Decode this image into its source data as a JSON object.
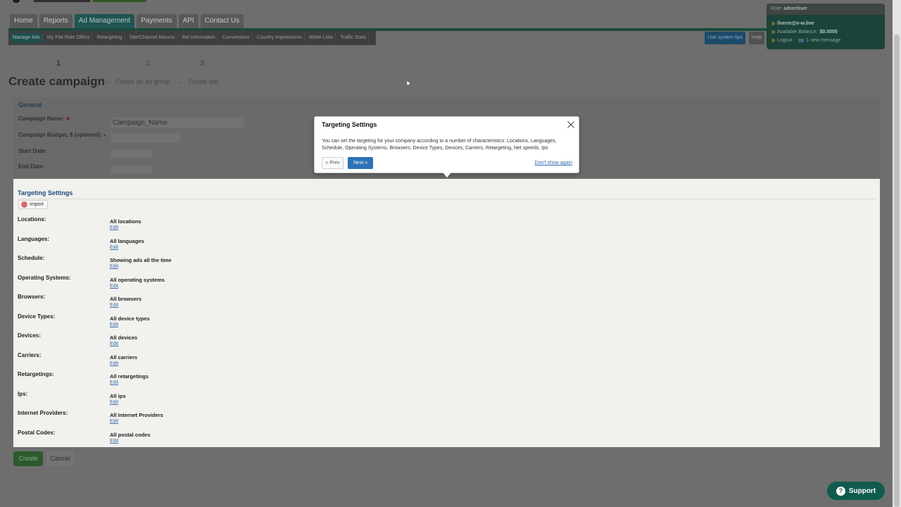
{
  "header": {
    "main_nav": [
      "Home",
      "Reports",
      "Ad Management",
      "Payments",
      "API",
      "Contact Us"
    ],
    "active_main": "Ad Management",
    "sub_nav": [
      "Manage Ads",
      "My Flat Rate Offers",
      "Retargeting",
      "Site/Channel Macros",
      "Bid Information",
      "Conversions",
      "Country Impressions",
      "White Lists",
      "Traffic Stats"
    ],
    "tips_label": "Use system tips",
    "help_label": "Help"
  },
  "user": {
    "role_label": "Role:",
    "role": "advertiser",
    "email": "ilverm@e-w.live",
    "balance_label": "Available Balance:",
    "balance": "$0.0000",
    "logout": "Logout",
    "messages": "1 new message"
  },
  "wizard": {
    "title": "Create campaign",
    "steps": [
      {
        "num": "1",
        "label": ""
      },
      {
        "num": "2",
        "label": "Create an ad group"
      },
      {
        "num": "3",
        "label": "Create ads"
      }
    ],
    "arrow": "→"
  },
  "general": {
    "heading": "General",
    "campaign_name_label": "Campaign Name:",
    "campaign_name_value": "Campaign_Name",
    "budget_label": "Campaign Budget, $ (optional):",
    "start_date_label": "Start Date:",
    "end_date_label": "End Date:"
  },
  "targeting": {
    "heading": "Targeting Settings",
    "import_label": "Import",
    "edit_label": "Edit",
    "rows": [
      {
        "label": "Locations:",
        "value": "All locations"
      },
      {
        "label": "Languages:",
        "value": "All languages"
      },
      {
        "label": "Schedule:",
        "value": "Showing ads all the time"
      },
      {
        "label": "Operating Systems:",
        "value": "All operating systems"
      },
      {
        "label": "Browsers:",
        "value": "All browsers"
      },
      {
        "label": "Device Types:",
        "value": "All device types"
      },
      {
        "label": "Devices:",
        "value": "All devices"
      },
      {
        "label": "Carriers:",
        "value": "All carriers"
      },
      {
        "label": "Retargetings:",
        "value": "All retargetings"
      },
      {
        "label": "Ips:",
        "value": "All ips"
      },
      {
        "label": "Internet Providers:",
        "value": "All Internet Providers"
      },
      {
        "label": "Postal Codes:",
        "value": "All postal codes"
      }
    ]
  },
  "actions": {
    "create": "Create",
    "cancel": "Cancel"
  },
  "support": {
    "label": "Support",
    "icon_glyph": "?"
  },
  "popover": {
    "title": "Targeting Settings",
    "body": "You can set the targeting for your company according to a number of characteristics: Locations, Languages, Schedule, Operating Systems, Browsers, Device Types, Devices, Carriers, Retargeting, Net speeds, Ips",
    "prev": "« Prev",
    "next": "Next »",
    "dont_show": "Don't show again"
  },
  "colors": {
    "accent_green": "#0f5c4e",
    "next_blue": "#2c72b6",
    "link_blue": "#3a6ea8",
    "overlay": "#6e6e6e"
  }
}
